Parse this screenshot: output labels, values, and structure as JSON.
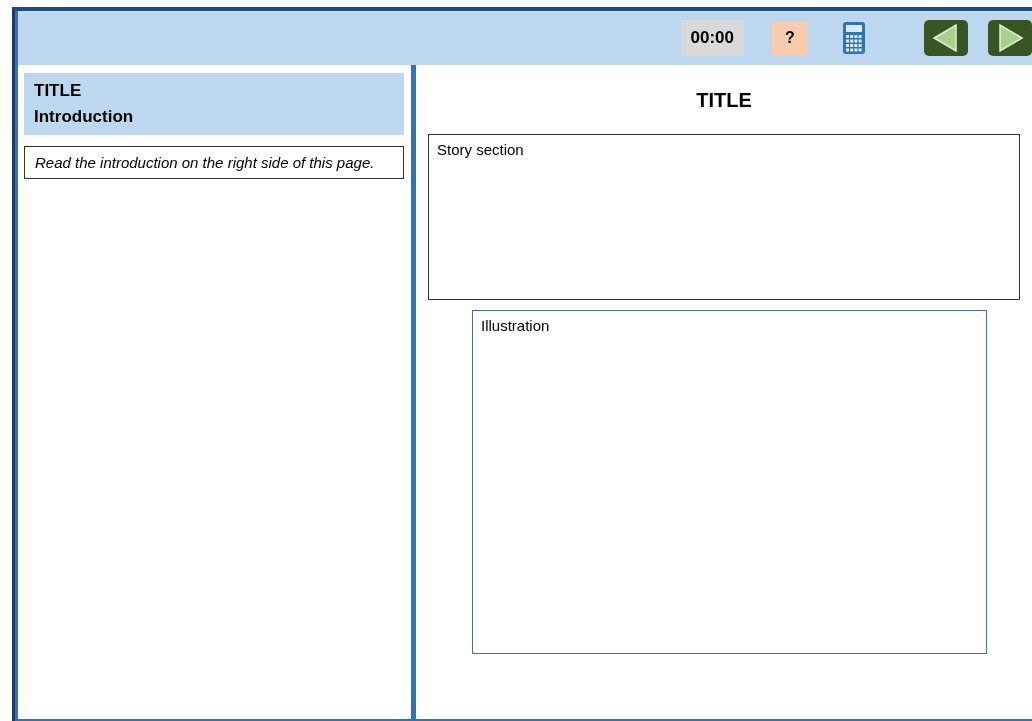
{
  "toolbar": {
    "timer": "00:00",
    "help": "?",
    "tools": [
      {
        "kind": "calculator"
      },
      {
        "kind": "back"
      },
      {
        "kind": "forward"
      }
    ]
  },
  "left_panel": {
    "title": "TITLE",
    "subtitle": "Introduction",
    "instruction": "Read the introduction on the right side of this page."
  },
  "right_panel": {
    "title": "TITLE",
    "story_section": "Story section",
    "illustration": "Illustration"
  }
}
